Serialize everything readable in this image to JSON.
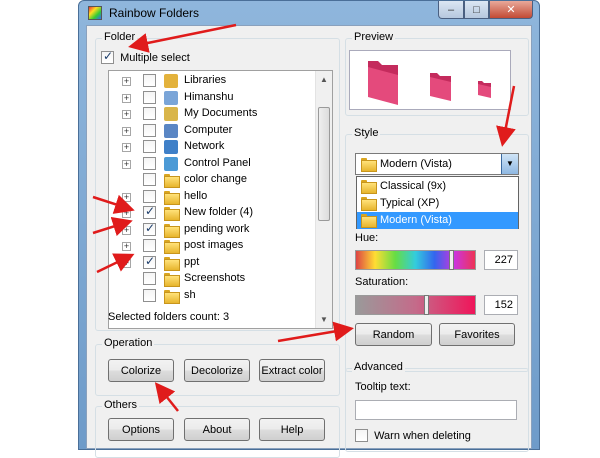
{
  "window": {
    "title": "Rainbow Folders"
  },
  "folder_group": {
    "label": "Folder",
    "multiple_select_label": "Multiple select",
    "multiple_select_checked": true,
    "tree": [
      {
        "label": "Libraries",
        "expandable": true,
        "checked": false,
        "icon": "libraries-icon"
      },
      {
        "label": "Himanshu",
        "expandable": true,
        "checked": false,
        "icon": "user-folder-icon"
      },
      {
        "label": "My Documents",
        "expandable": true,
        "checked": false,
        "icon": "documents-icon"
      },
      {
        "label": "Computer",
        "expandable": true,
        "checked": false,
        "icon": "computer-icon"
      },
      {
        "label": "Network",
        "expandable": true,
        "checked": false,
        "icon": "network-icon"
      },
      {
        "label": "Control Panel",
        "expandable": true,
        "checked": false,
        "icon": "control-panel-icon"
      },
      {
        "label": "color change",
        "expandable": false,
        "checked": false,
        "icon": "folder-icon"
      },
      {
        "label": "hello",
        "expandable": true,
        "checked": false,
        "icon": "folder-icon"
      },
      {
        "label": "New folder (4)",
        "expandable": true,
        "checked": true,
        "icon": "folder-icon"
      },
      {
        "label": "pending work",
        "expandable": true,
        "checked": true,
        "icon": "folder-icon"
      },
      {
        "label": "post images",
        "expandable": true,
        "checked": false,
        "icon": "folder-icon"
      },
      {
        "label": "ppt",
        "expandable": true,
        "checked": true,
        "icon": "folder-icon"
      },
      {
        "label": "Screenshots",
        "expandable": false,
        "checked": false,
        "icon": "folder-icon"
      },
      {
        "label": "sh",
        "expandable": false,
        "checked": false,
        "icon": "folder-icon"
      }
    ],
    "selected_count_text": "Selected folders count: 3"
  },
  "operation_group": {
    "label": "Operation",
    "colorize": "Colorize",
    "decolorize": "Decolorize",
    "extract_color": "Extract color"
  },
  "others_group": {
    "label": "Others",
    "options": "Options",
    "about": "About",
    "help": "Help"
  },
  "preview_group": {
    "label": "Preview"
  },
  "style_group": {
    "label": "Style",
    "selected": "Modern (Vista)",
    "options": [
      "Classical (9x)",
      "Typical (XP)",
      "Modern (Vista)"
    ],
    "hue_label": "Hue:",
    "hue_value": "227",
    "hue_level": 0.82,
    "saturation_label": "Saturation:",
    "saturation_value": "152",
    "saturation_level": 0.6,
    "random": "Random",
    "favorites": "Favorites"
  },
  "advanced_group": {
    "label": "Advanced",
    "tooltip_label": "Tooltip text:",
    "tooltip_value": "",
    "warn_label": "Warn when deleting",
    "warn_checked": false
  },
  "colors": {
    "folder_preview": "#d9356a",
    "annotation_arrow": "#e01b1b",
    "selection": "#3399ff"
  }
}
